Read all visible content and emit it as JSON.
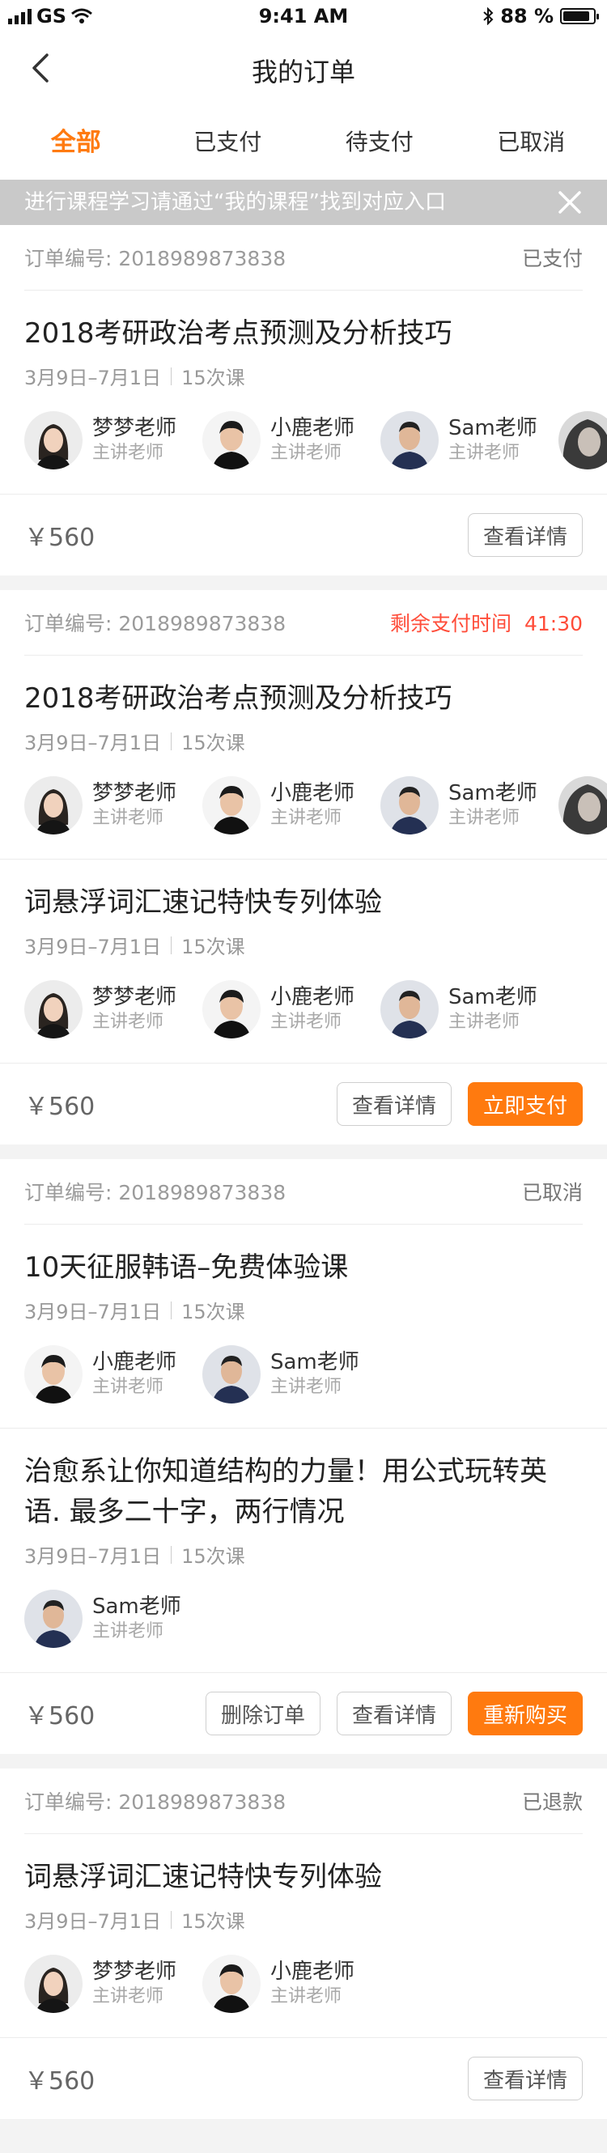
{
  "status_bar": {
    "carrier": "GS",
    "time": "9:41 AM",
    "battery": "88 %"
  },
  "nav": {
    "title": "我的订单"
  },
  "tabs": [
    {
      "label": "全部",
      "active": true
    },
    {
      "label": "已支付",
      "active": false
    },
    {
      "label": "待支付",
      "active": false
    },
    {
      "label": "已取消",
      "active": false
    }
  ],
  "notice": {
    "text": "进行课程学习请通过“我的课程”找到对应入口"
  },
  "common": {
    "role": "主讲老师",
    "lessons": "15次课",
    "date_range": "3月9日–7月1日",
    "view_detail": "查看详情"
  },
  "orders": [
    {
      "order_label": "订单编号:  2018989873838",
      "status": "已支付",
      "courses": [
        {
          "title": "2018考研政治考点预测及分析技巧",
          "date": "3月9日–7月1日",
          "lessons": "15次课",
          "teachers": [
            {
              "name": "梦梦老师"
            },
            {
              "name": "小鹿老师"
            },
            {
              "name": "Sam老师"
            }
          ]
        }
      ],
      "price": "￥560",
      "buttons": [
        {
          "label": "查看详情",
          "primary": false
        }
      ]
    },
    {
      "order_label": "订单编号:  2018989873838",
      "countdown_label": "剩余支付时间",
      "countdown_time": "41:30",
      "courses": [
        {
          "title": "2018考研政治考点预测及分析技巧",
          "date": "3月9日–7月1日",
          "lessons": "15次课",
          "teachers": [
            {
              "name": "梦梦老师"
            },
            {
              "name": "小鹿老师"
            },
            {
              "name": "Sam老师"
            }
          ]
        },
        {
          "title": "词悬浮词汇速记特快专列体验",
          "date": "3月9日–7月1日",
          "lessons": "15次课",
          "teachers": [
            {
              "name": "梦梦老师"
            },
            {
              "name": "小鹿老师"
            },
            {
              "name": "Sam老师"
            }
          ]
        }
      ],
      "price": "￥560",
      "buttons": [
        {
          "label": "查看详情",
          "primary": false
        },
        {
          "label": "立即支付",
          "primary": true
        }
      ]
    },
    {
      "order_label": "订单编号:  2018989873838",
      "status": "已取消",
      "courses": [
        {
          "title": "10天征服韩语–免费体验课",
          "date": "3月9日–7月1日",
          "lessons": "15次课",
          "teachers": [
            {
              "name": "小鹿老师"
            },
            {
              "name": "Sam老师"
            }
          ]
        },
        {
          "title": "治愈系让你知道结构的力量！用公式玩转英语. 最多二十字，两行情况",
          "date": "3月9日–7月1日",
          "lessons": "15次课",
          "teachers": [
            {
              "name": "Sam老师"
            }
          ]
        }
      ],
      "price": "￥560",
      "buttons": [
        {
          "label": "删除订单",
          "primary": false
        },
        {
          "label": "查看详情",
          "primary": false
        },
        {
          "label": "重新购买",
          "primary": true
        }
      ]
    },
    {
      "order_label": "订单编号:  2018989873838",
      "status": "已退款",
      "courses": [
        {
          "title": "词悬浮词汇速记特快专列体验",
          "date": "3月9日–7月1日",
          "lessons": "15次课",
          "teachers": [
            {
              "name": "梦梦老师"
            },
            {
              "name": "小鹿老师"
            }
          ]
        }
      ],
      "price": "￥560",
      "buttons": [
        {
          "label": "查看详情",
          "primary": false
        }
      ]
    }
  ],
  "colors": {
    "accent": "#ff7a0f",
    "countdown": "#ff4d3a",
    "notice_bg": "#c9c9c9"
  }
}
